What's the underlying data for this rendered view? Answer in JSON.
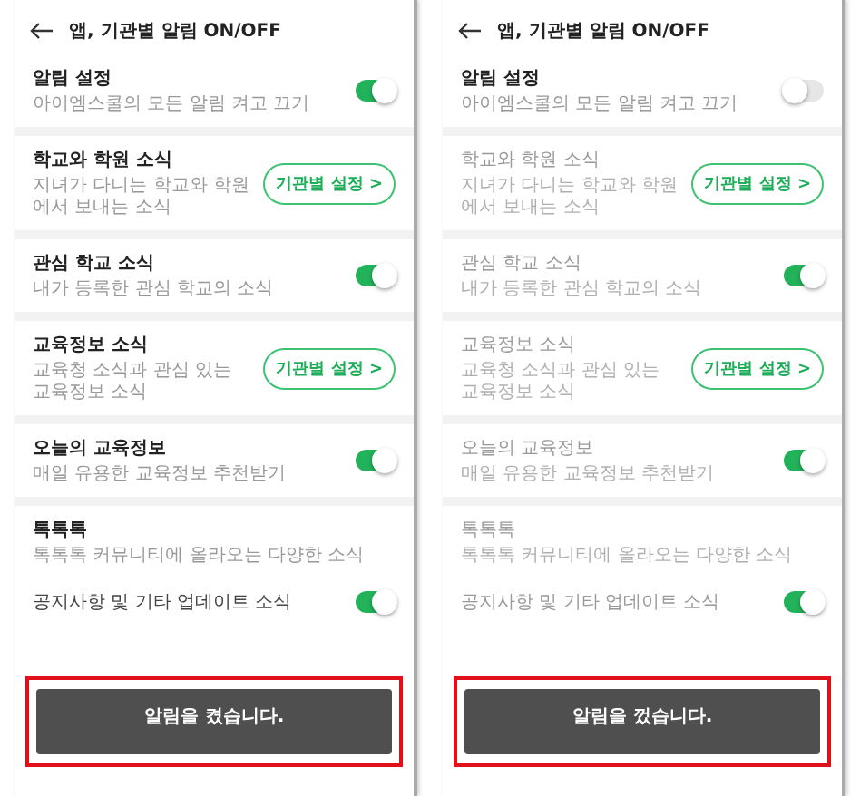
{
  "panels": [
    {
      "title": "앱, 기관별 알림 ON/OFF",
      "master": {
        "title": "알림 설정",
        "subtitle": "아이엠스쿨의 모든 알림 켜고 끄기",
        "on": true
      },
      "sections": [
        {
          "kind": "button",
          "title": "학교와 학원 소식",
          "subtitle": "지녀가 다니는 학교와 학원에서 보내는 소식",
          "button": "기관별 설정 >",
          "disabled": false
        },
        {
          "kind": "toggle",
          "title": "관심 학교 소식",
          "subtitle": "내가 등록한 관심 학교의 소식",
          "on": true,
          "disabled": false
        },
        {
          "kind": "button",
          "title": "교육정보 소식",
          "subtitle": "교육청 소식과 관심 있는 교육정보 소식",
          "button": "기관별 설정 >",
          "disabled": false
        },
        {
          "kind": "toggle",
          "title": "오늘의 교육정보",
          "subtitle": "매일 유용한 교육정보 추천받기",
          "on": true,
          "disabled": false
        },
        {
          "kind": "group",
          "title": "톡톡톡",
          "subtitle": "톡톡톡 커뮤니티에 올라오는 다양한 소식",
          "disabled": false,
          "items": [
            {
              "label": "공지사항 및 기타 업데이트 소식",
              "on": true
            }
          ]
        }
      ],
      "toast": "알림을 켰습니다."
    },
    {
      "title": "앱, 기관별 알림 ON/OFF",
      "master": {
        "title": "알림 설정",
        "subtitle": "아이엠스쿨의 모든 알림 켜고 끄기",
        "on": false
      },
      "sections": [
        {
          "kind": "button",
          "title": "학교와 학원 소식",
          "subtitle": "지녀가 다니는 학교와 학원에서 보내는 소식",
          "button": "기관별 설정 >",
          "disabled": true
        },
        {
          "kind": "toggle",
          "title": "관심 학교 소식",
          "subtitle": "내가 등록한 관심 학교의 소식",
          "on": true,
          "disabled": true
        },
        {
          "kind": "button",
          "title": "교육정보 소식",
          "subtitle": "교육청 소식과 관심 있는 교육정보 소식",
          "button": "기관별 설정 >",
          "disabled": true
        },
        {
          "kind": "toggle",
          "title": "오늘의 교육정보",
          "subtitle": "매일 유용한 교육정보 추천받기",
          "on": true,
          "disabled": true
        },
        {
          "kind": "group",
          "title": "톡톡톡",
          "subtitle": "톡톡톡 커뮤니티에 올라오는 다양한 소식",
          "disabled": true,
          "items": [
            {
              "label": "공지사항 및 기타 업데이트 소식",
              "on": true
            }
          ]
        }
      ],
      "toast": "알림을 껐습니다."
    }
  ]
}
